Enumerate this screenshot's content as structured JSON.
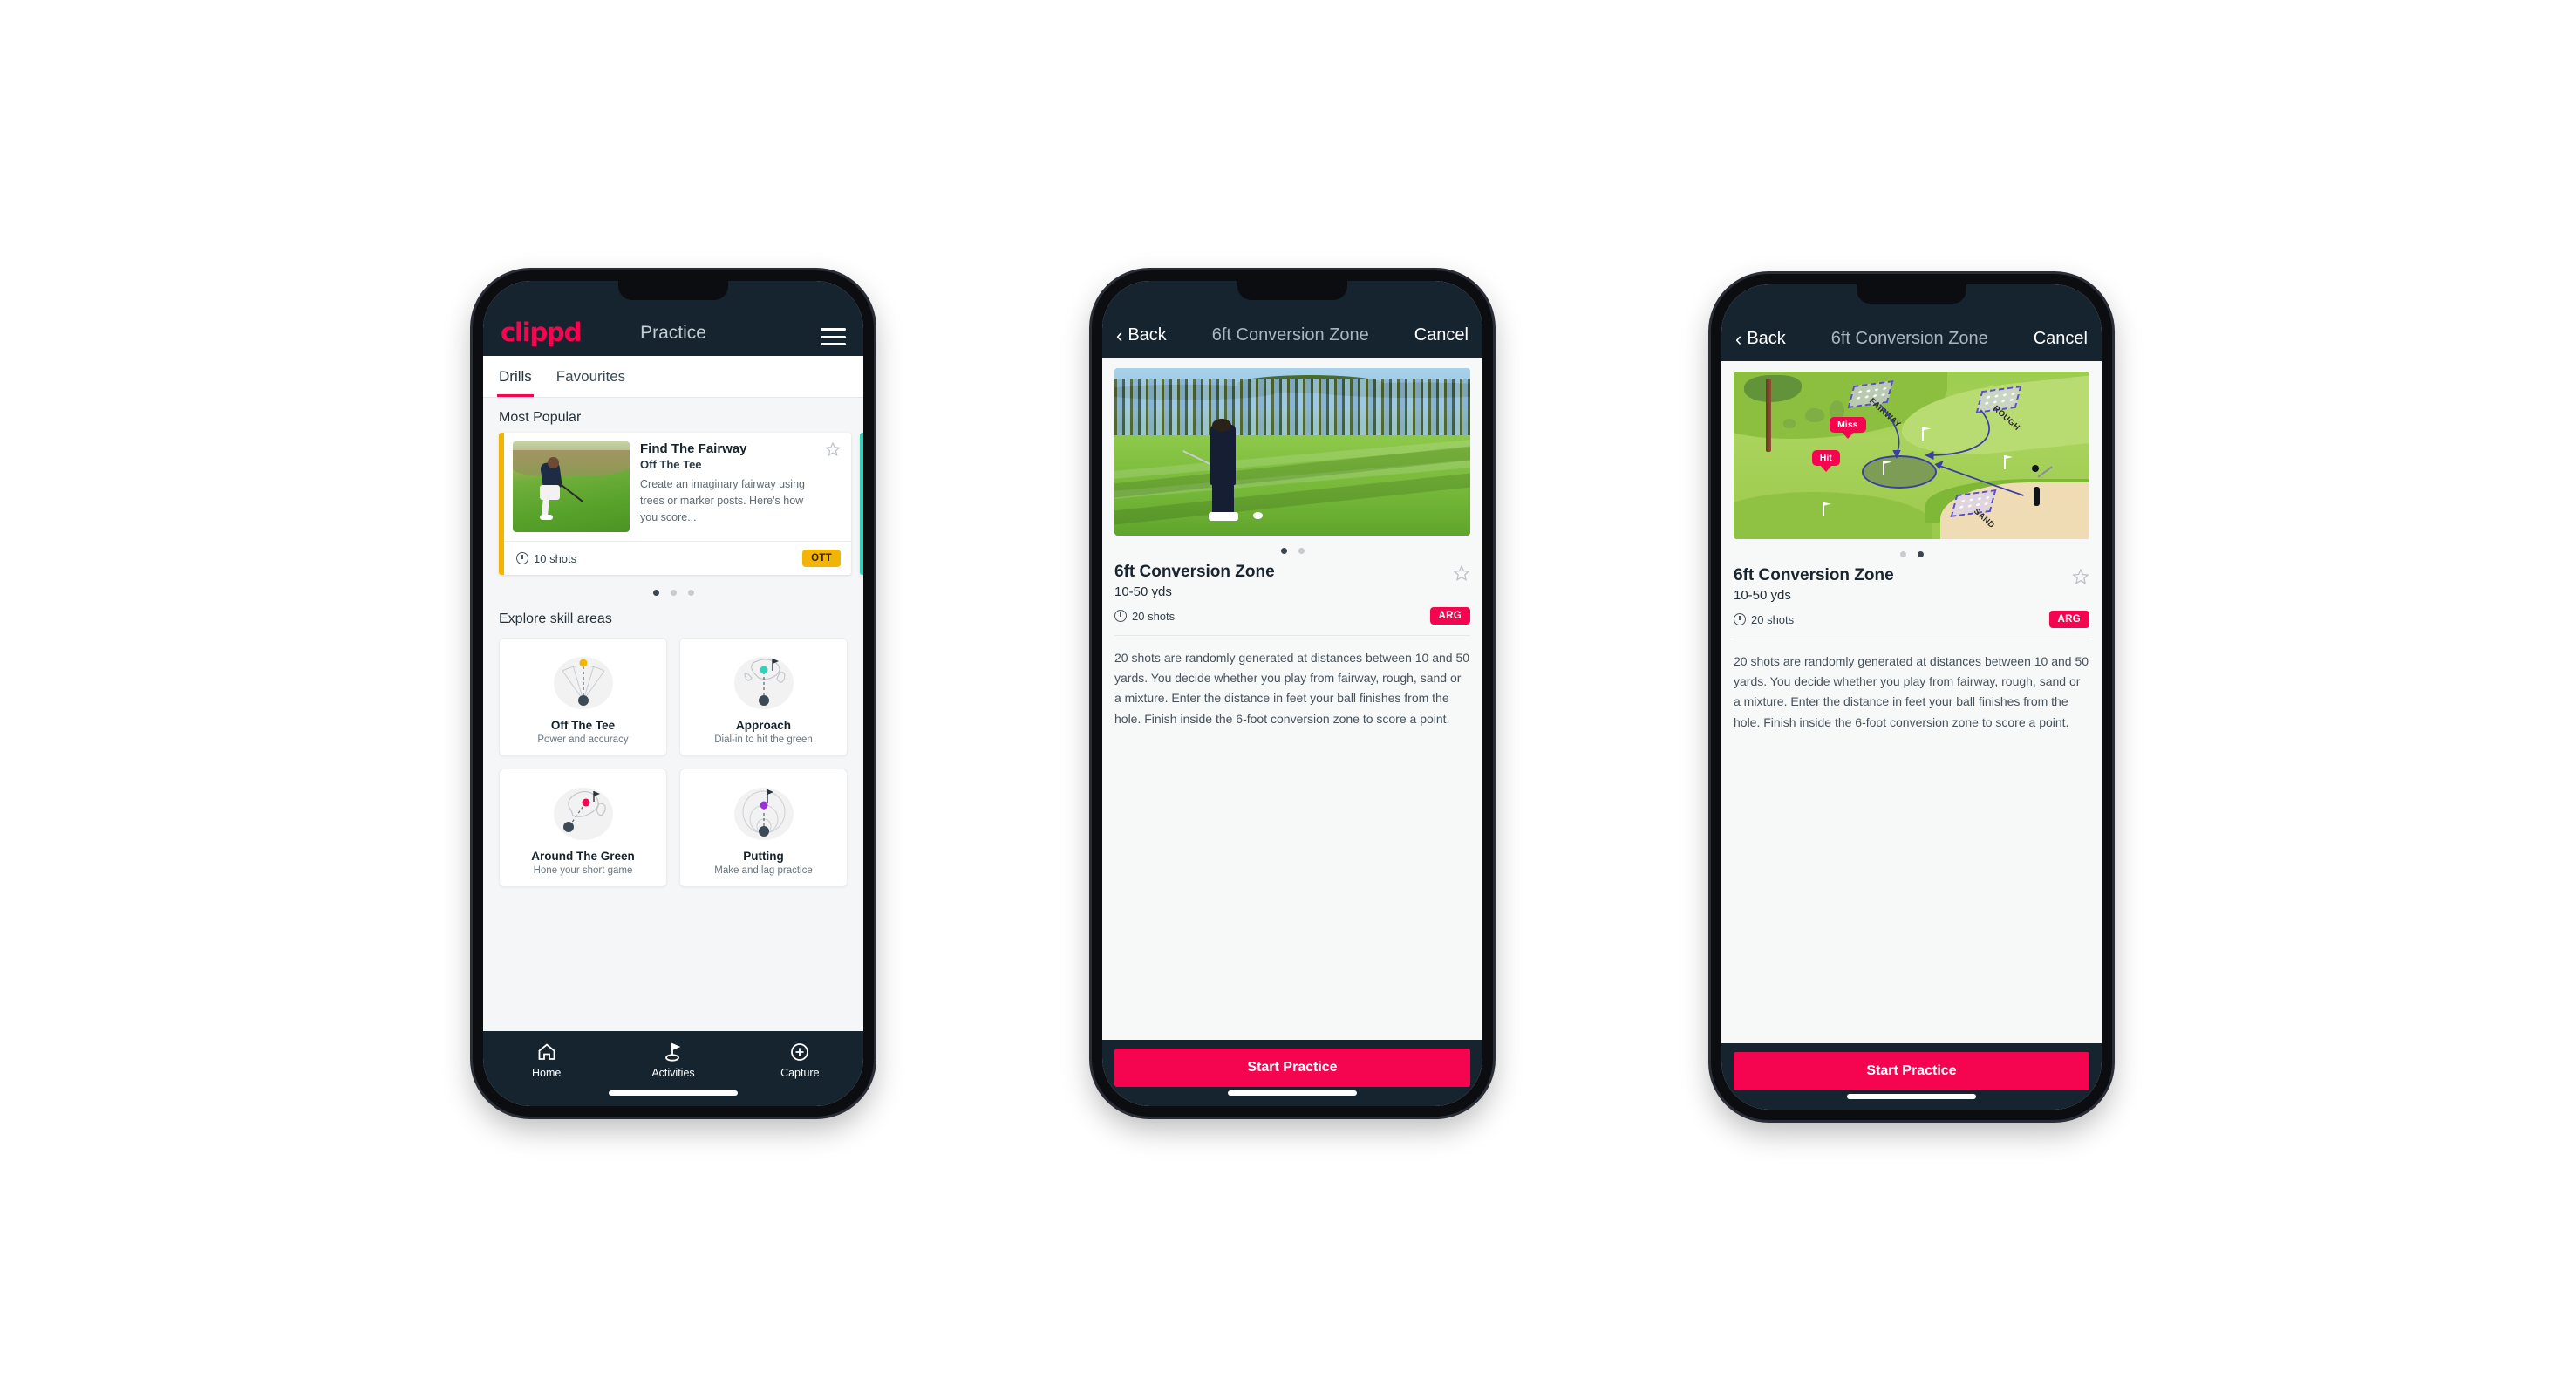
{
  "app": {
    "brand": "clippd",
    "accent_pink": "#f5054f",
    "header_dark": "#16242f",
    "ott_yellow": "#f2b505",
    "teal": "#2fd3bb"
  },
  "phone1": {
    "appbar": {
      "title": "Practice",
      "menu_icon": "hamburger-menu-icon"
    },
    "tabs": [
      {
        "label": "Drills",
        "active": true
      },
      {
        "label": "Favourites",
        "active": false
      }
    ],
    "most_popular": {
      "section_label": "Most Popular",
      "card": {
        "title": "Find The Fairway",
        "subtitle": "Off The Tee",
        "description": "Create an imaginary fairway using trees or marker posts. Here's how you score...",
        "shots": "10 shots",
        "badge": "OTT",
        "accent": "#f2b505",
        "favourite_icon": "star-outline-icon"
      },
      "carousel_dots": 3,
      "carousel_active": 1
    },
    "explore": {
      "section_label": "Explore skill areas",
      "cards": [
        {
          "name": "Off The Tee",
          "desc": "Power and accuracy",
          "icon": "tee-shot-fan-icon",
          "dot_color": "#f2b505"
        },
        {
          "name": "Approach",
          "desc": "Dial-in to hit the green",
          "icon": "approach-green-icon",
          "dot_color": "#2fd3bb"
        },
        {
          "name": "Around The Green",
          "desc": "Hone your short game",
          "icon": "chip-green-icon",
          "dot_color": "#f5054f"
        },
        {
          "name": "Putting",
          "desc": "Make and lag practice",
          "icon": "putting-rings-icon",
          "dot_color": "#9b30d9"
        }
      ]
    },
    "tabbar": [
      {
        "label": "Home",
        "icon": "home-icon",
        "active": false
      },
      {
        "label": "Activities",
        "icon": "golf-flag-icon",
        "active": true
      },
      {
        "label": "Capture",
        "icon": "plus-circle-icon",
        "active": false
      }
    ]
  },
  "phone2": {
    "navbar": {
      "back": "Back",
      "title": "6ft Conversion Zone",
      "cancel": "Cancel",
      "back_icon": "chevron-left-icon"
    },
    "media": {
      "type": "photo",
      "alt": "golfer chipping on green with pine trees"
    },
    "carousel_dots": 2,
    "carousel_active": 1,
    "detail": {
      "title": "6ft Conversion Zone",
      "subtitle": "10-50 yds",
      "shots": "20 shots",
      "badge": "ARG",
      "favourite_icon": "star-outline-icon",
      "description": "20 shots are randomly generated at distances between 10 and 50 yards. You decide whether you play from fairway, rough, sand or a mixture. Enter the distance in feet your ball finishes from the hole. Finish inside the 6-foot conversion zone to score a point."
    },
    "cta": "Start Practice"
  },
  "phone3": {
    "navbar": {
      "back": "Back",
      "title": "6ft Conversion Zone",
      "cancel": "Cancel",
      "back_icon": "chevron-left-icon"
    },
    "media": {
      "type": "illustration",
      "zone_labels": [
        "FAIRWAY",
        "ROUGH",
        "SAND"
      ],
      "callouts": [
        "Miss",
        "Hit"
      ]
    },
    "carousel_dots": 2,
    "carousel_active": 2,
    "detail": {
      "title": "6ft Conversion Zone",
      "subtitle": "10-50 yds",
      "shots": "20 shots",
      "badge": "ARG",
      "favourite_icon": "star-outline-icon",
      "description": "20 shots are randomly generated at distances between 10 and 50 yards. You decide whether you play from fairway, rough, sand or a mixture. Enter the distance in feet your ball finishes from the hole. Finish inside the 6-foot conversion zone to score a point."
    },
    "cta": "Start Practice"
  }
}
